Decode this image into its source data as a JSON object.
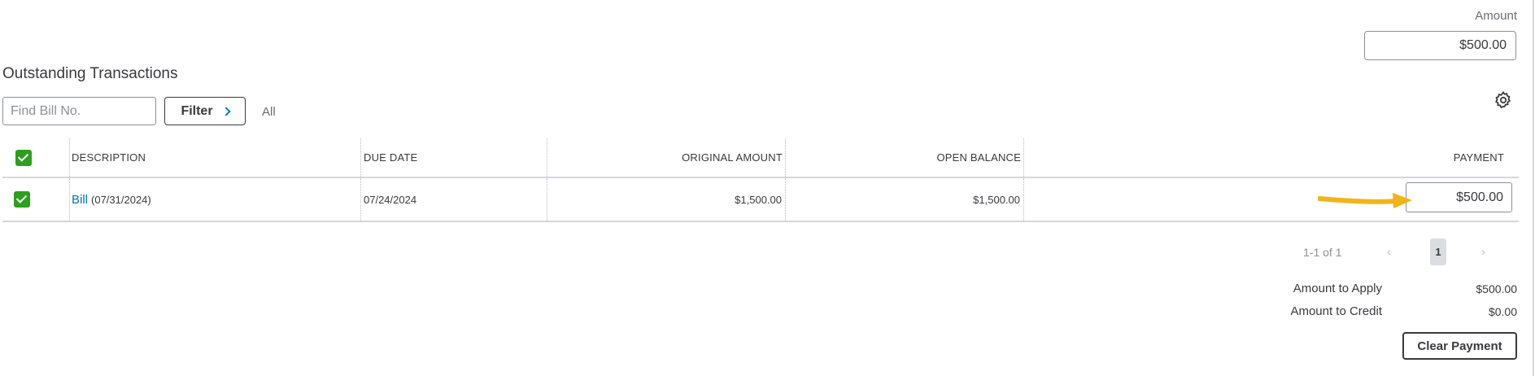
{
  "header": {
    "amount_label": "Amount",
    "amount_value": "$500.00"
  },
  "section_title": "Outstanding Transactions",
  "toolbar": {
    "find_placeholder": "Find Bill No.",
    "filter_label": "Filter",
    "filter_status": "All"
  },
  "table": {
    "columns": [
      "DESCRIPTION",
      "DUE DATE",
      "ORIGINAL AMOUNT",
      "OPEN BALANCE",
      "PAYMENT"
    ],
    "rows": [
      {
        "checked": true,
        "description_link": "Bill",
        "description_date": "(07/31/2024)",
        "due_date": "07/24/2024",
        "original_amount": "$1,500.00",
        "open_balance": "$1,500.00",
        "payment": "$500.00"
      }
    ]
  },
  "pagination": {
    "range_text": "1-1 of 1",
    "prev": "‹",
    "current_page": "1",
    "next": "›"
  },
  "summary": {
    "apply_label": "Amount to Apply",
    "apply_value": "$500.00",
    "credit_label": "Amount to Credit",
    "credit_value": "$0.00"
  },
  "clear_button_label": "Clear Payment",
  "colors": {
    "checkbox_green": "#2ca01c",
    "link_blue": "#0077c5",
    "annotation_arrow": "#f2b418"
  },
  "icons": {
    "settings": "gear-icon",
    "filter_chevron": "chevron-right-icon",
    "annotation": "arrow-icon"
  }
}
